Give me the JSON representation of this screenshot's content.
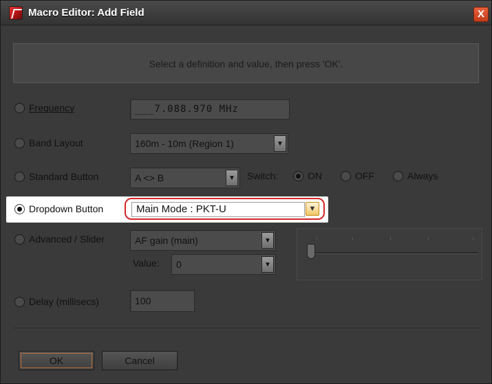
{
  "window": {
    "title": "Macro Editor: Add Field",
    "close_label": "X"
  },
  "instruction": "Select a definition and value, then press 'OK'.",
  "options": {
    "frequency": {
      "label": "Frequency",
      "value": "___7.088.970 MHz"
    },
    "band_layout": {
      "label": "Band Layout",
      "value": "160m - 10m (Region 1)"
    },
    "standard_button": {
      "label": "Standard Button",
      "value": "A <> B",
      "switch_label": "Switch:",
      "on": "ON",
      "off": "OFF",
      "always": "Always"
    },
    "dropdown_button": {
      "label": "Dropdown Button",
      "value": "Main Mode : PKT-U"
    },
    "advanced": {
      "label": "Advanced / Slider",
      "value": "AF gain (main)",
      "value_label": "Value:",
      "value_value": "0"
    },
    "delay": {
      "label": "Delay (millisecs)",
      "value": "100"
    }
  },
  "buttons": {
    "ok": "OK",
    "cancel": "Cancel"
  }
}
